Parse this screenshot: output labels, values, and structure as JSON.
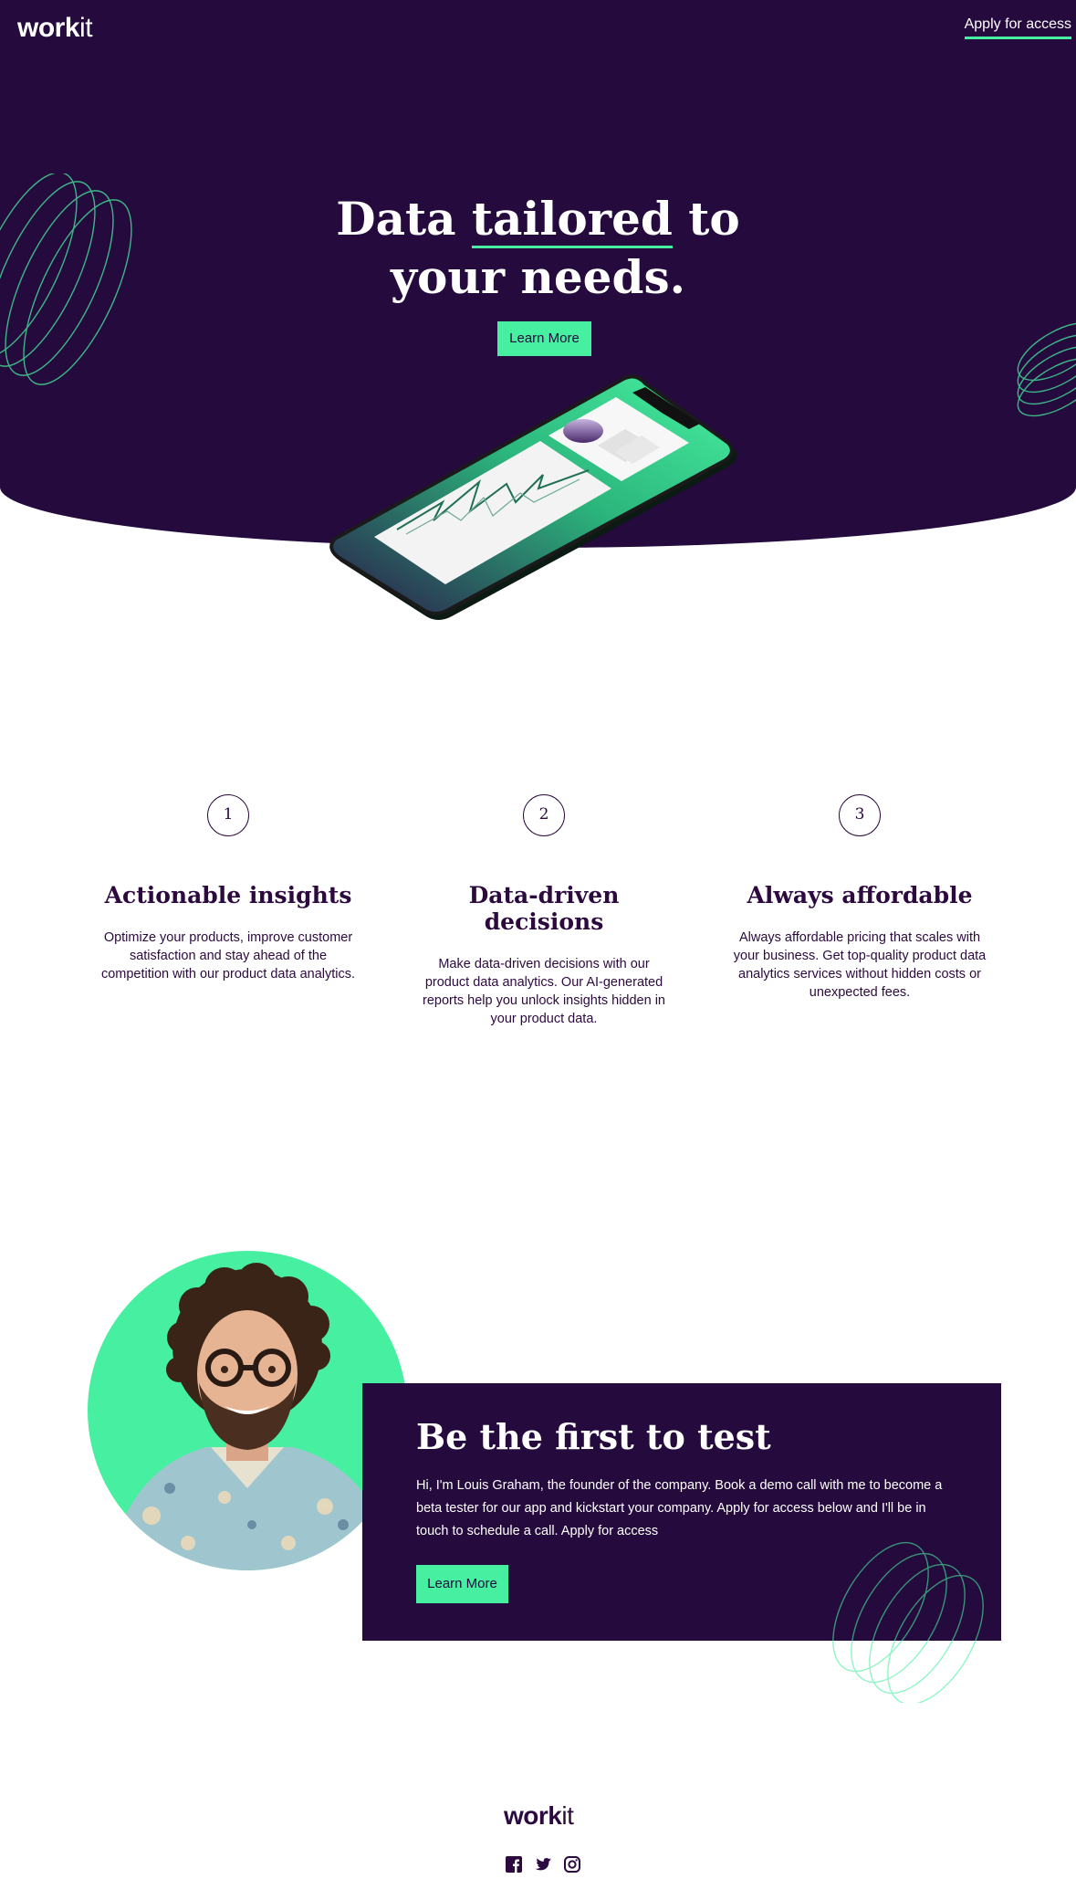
{
  "header": {
    "logo_bold": "work",
    "logo_light": "it",
    "apply_link": "Apply for access"
  },
  "hero": {
    "title_part1": "Data ",
    "title_underlined": "tailored",
    "title_part2": " to",
    "title_line2": "your needs.",
    "button_label": "Learn More"
  },
  "features": [
    {
      "number": "1",
      "title": "Actionable insights",
      "text": "Optimize your products, improve customer satisfaction and stay ahead of the competition with our product data analytics."
    },
    {
      "number": "2",
      "title": "Data-driven decisions",
      "text": "Make data-driven decisions with our product data analytics. Our AI-generated reports help you unlock insights hidden in your product data."
    },
    {
      "number": "3",
      "title": "Always affordable",
      "text": "Always affordable pricing that scales with your business. Get top-quality product data analytics services without hidden costs or unexpected fees."
    }
  ],
  "cta": {
    "title": "Be the first to test",
    "text": "Hi, I'm Louis Graham, the founder of the company. Book a demo call with me to become a beta tester for our app and kickstart your company. Apply for access below and I'll be in touch to schedule a call. Apply for access",
    "button_label": "Learn More"
  },
  "footer": {
    "logo_bold": "work",
    "logo_light": "it",
    "socials": [
      "facebook-icon",
      "twitter-icon",
      "instagram-icon"
    ]
  },
  "colors": {
    "dark_purple": "#250a3d",
    "accent_green": "#47f0a0",
    "white": "#ffffff"
  }
}
